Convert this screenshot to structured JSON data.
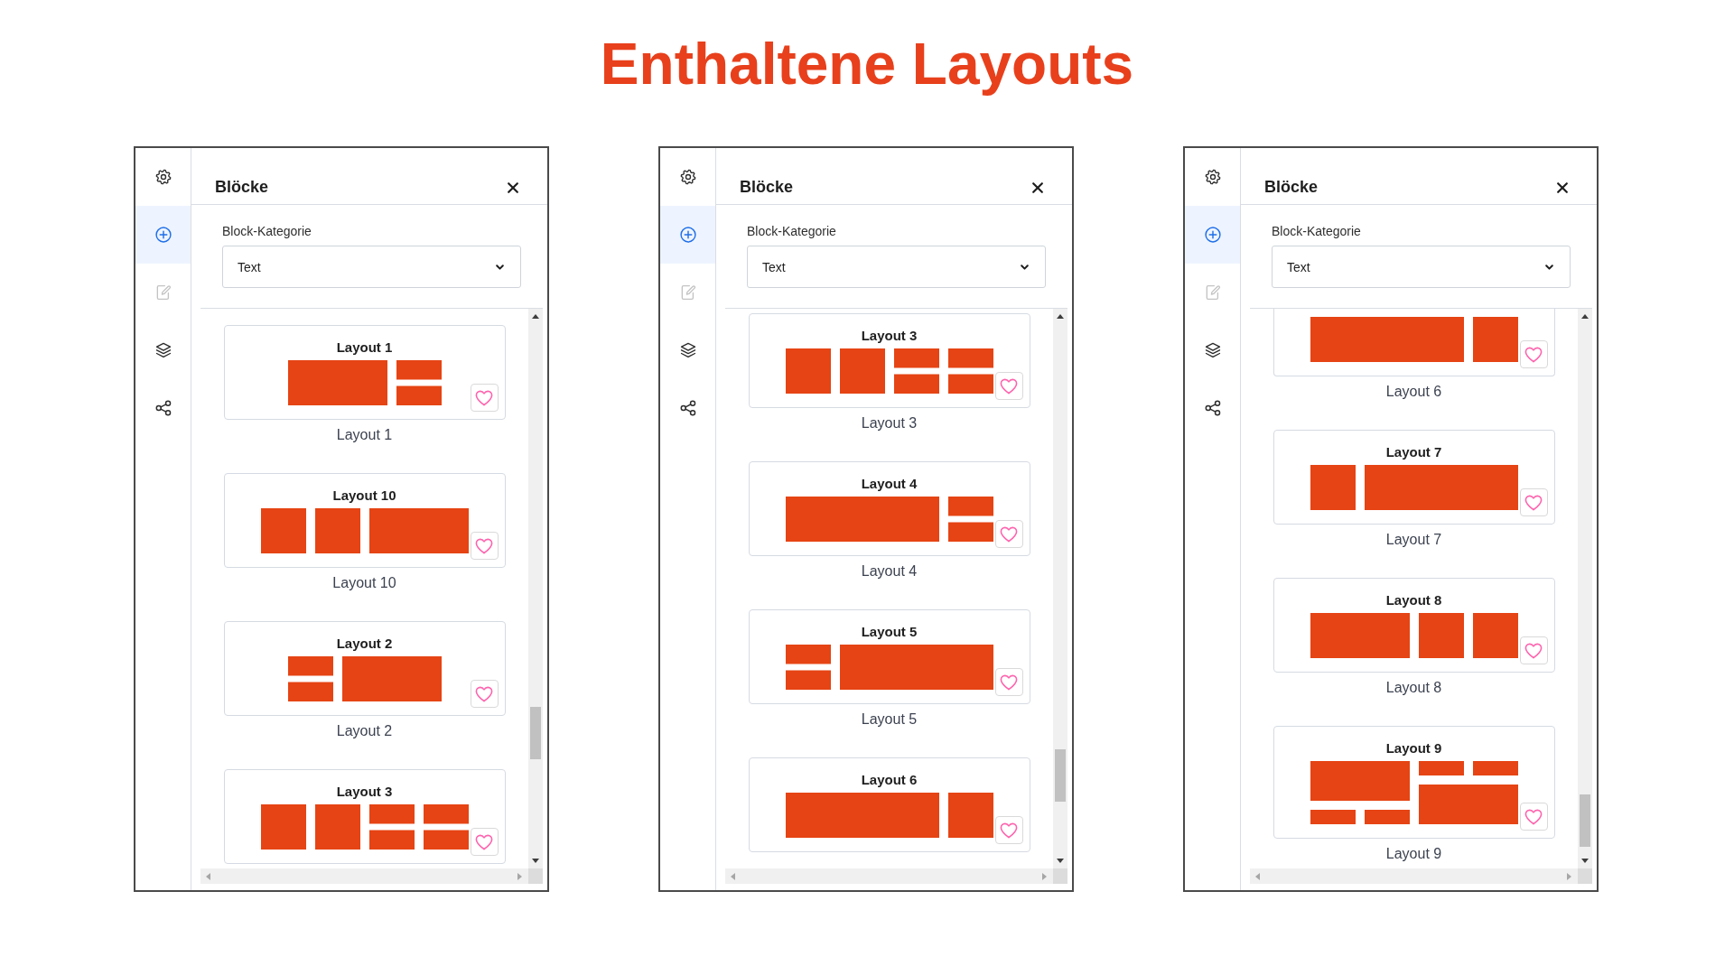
{
  "title": "Enthaltene Layouts",
  "panels": [
    {
      "sidebar": [
        {
          "kind": "settings",
          "selected": false,
          "disabled": false
        },
        {
          "kind": "add",
          "selected": true,
          "disabled": false
        },
        {
          "kind": "edit",
          "selected": false,
          "disabled": true
        },
        {
          "kind": "layers",
          "selected": false,
          "disabled": false
        },
        {
          "kind": "share",
          "selected": false,
          "disabled": false
        }
      ],
      "header": {
        "title": "Blöcke"
      },
      "category": {
        "label": "Block-Kategorie",
        "value": "Text"
      },
      "layouts": [
        {
          "title": "Layout 1",
          "caption": "Layout 1",
          "favorited": false,
          "preview": [
            {
              "kind": "wide"
            },
            {
              "kind": "split"
            }
          ]
        },
        {
          "title": "Layout 10",
          "caption": "Layout 10",
          "favorited": false,
          "preview": [
            {
              "kind": "single"
            },
            {
              "kind": "single"
            },
            {
              "kind": "wide"
            }
          ]
        },
        {
          "title": "Layout 2",
          "caption": "Layout 2",
          "favorited": false,
          "preview": [
            {
              "kind": "split"
            },
            {
              "kind": "wide"
            }
          ]
        },
        {
          "title": "Layout 3",
          "favorited": false,
          "preview": [
            {
              "kind": "single"
            },
            {
              "kind": "single"
            },
            {
              "kind": "split"
            },
            {
              "kind": "split"
            }
          ]
        }
      ]
    },
    {
      "sidebar": [
        {
          "kind": "settings",
          "selected": false,
          "disabled": false
        },
        {
          "kind": "add",
          "selected": true,
          "disabled": false
        },
        {
          "kind": "edit",
          "selected": false,
          "disabled": true
        },
        {
          "kind": "layers",
          "selected": false,
          "disabled": false
        },
        {
          "kind": "share",
          "selected": false,
          "disabled": false
        }
      ],
      "header": {
        "title": "Blöcke"
      },
      "category": {
        "label": "Block-Kategorie",
        "value": "Text"
      },
      "layouts": [
        {
          "title": "Layout 3",
          "caption": "Layout 3",
          "favorited": false,
          "preview": [
            {
              "kind": "single"
            },
            {
              "kind": "single"
            },
            {
              "kind": "split"
            },
            {
              "kind": "split"
            }
          ]
        },
        {
          "title": "Layout 4",
          "caption": "Layout 4",
          "favorited": false,
          "preview": [
            {
              "kind": "triple"
            },
            {
              "kind": "split"
            }
          ]
        },
        {
          "title": "Layout 5",
          "caption": "Layout 5",
          "favorited": false,
          "preview": [
            {
              "kind": "split"
            },
            {
              "kind": "triple"
            }
          ]
        },
        {
          "title": "Layout 6",
          "favorited": false,
          "preview": [
            {
              "kind": "triple"
            },
            {
              "kind": "single"
            }
          ]
        }
      ]
    },
    {
      "sidebar": [
        {
          "kind": "settings",
          "selected": false,
          "disabled": false
        },
        {
          "kind": "add",
          "selected": true,
          "disabled": false
        },
        {
          "kind": "edit",
          "selected": false,
          "disabled": true
        },
        {
          "kind": "layers",
          "selected": false,
          "disabled": false
        },
        {
          "kind": "share",
          "selected": false,
          "disabled": false
        }
      ],
      "header": {
        "title": "Blöcke"
      },
      "category": {
        "label": "Block-Kategorie",
        "value": "Text"
      },
      "layouts": [
        {
          "caption": "Layout 6",
          "favorited": false,
          "preview": [
            {
              "kind": "triple"
            },
            {
              "kind": "single"
            }
          ]
        },
        {
          "title": "Layout 7",
          "caption": "Layout 7",
          "favorited": false,
          "preview": [
            {
              "kind": "single"
            },
            {
              "kind": "triple"
            }
          ]
        },
        {
          "title": "Layout 8",
          "caption": "Layout 8",
          "favorited": false,
          "preview": [
            {
              "kind": "wide"
            },
            {
              "kind": "single"
            },
            {
              "kind": "single"
            }
          ]
        },
        {
          "title": "Layout 9",
          "caption": "Layout 9",
          "favorited": false,
          "preview": [
            {
              "kind": "heavytop"
            },
            {
              "kind": "heavybottom"
            }
          ]
        }
      ]
    }
  ]
}
